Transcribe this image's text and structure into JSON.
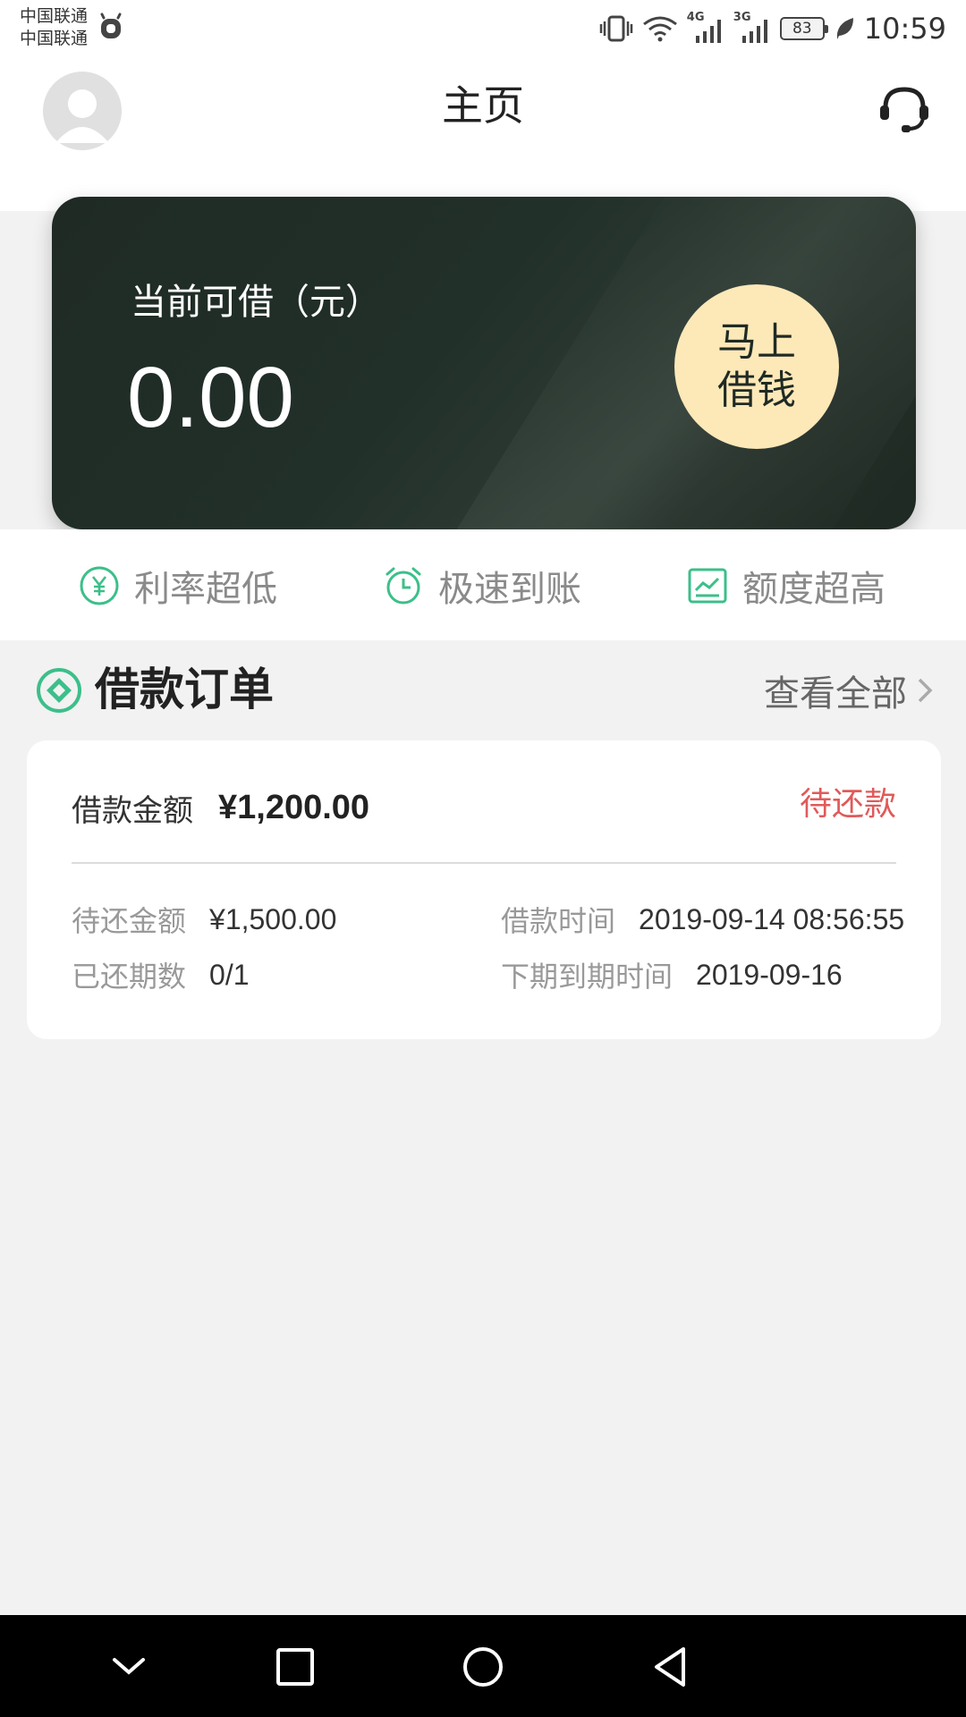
{
  "status_bar": {
    "carrier_1": "中国联通",
    "carrier_2": "中国联通",
    "network_4g": "4G",
    "network_3g": "3G",
    "battery": "83",
    "time": "10:59"
  },
  "header": {
    "title": "主页"
  },
  "credit_card": {
    "label": "当前可借（元）",
    "amount": "0.00",
    "borrow_button_line1": "马上",
    "borrow_button_line2": "借钱"
  },
  "features": [
    {
      "label": "利率超低",
      "icon": "yuan-icon"
    },
    {
      "label": "极速到账",
      "icon": "alarm-clock-icon"
    },
    {
      "label": "额度超高",
      "icon": "chart-icon"
    }
  ],
  "orders": {
    "title": "借款订单",
    "view_all": "查看全部",
    "order": {
      "amount_label": "借款金额",
      "amount_value": "¥1,200.00",
      "status": "待还款",
      "pending_label": "待还金额",
      "pending_value": "¥1,500.00",
      "periods_label": "已还期数",
      "periods_value": "0/1",
      "borrow_time_label": "借款时间",
      "borrow_time_value": "2019-09-14 08:56:55",
      "due_label": "下期到期时间",
      "due_value": "2019-09-16"
    }
  },
  "colors": {
    "accent_green": "#3cbf8a",
    "card_dark": "#1f2a24",
    "button_cream": "#fde8b8",
    "status_red": "#e05a5a"
  }
}
